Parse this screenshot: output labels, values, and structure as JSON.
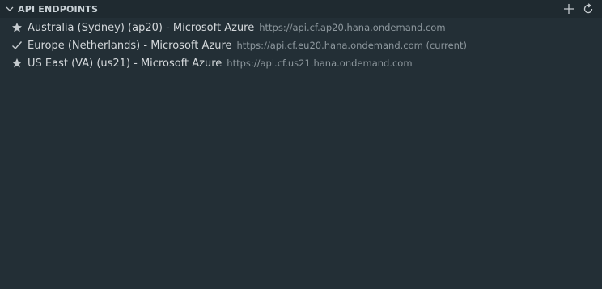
{
  "header": {
    "title": "API ENDPOINTS",
    "chevron_icon": "chevron-down-icon",
    "actions": [
      {
        "name": "add-button",
        "icon": "plus-icon"
      },
      {
        "name": "refresh-button",
        "icon": "refresh-icon"
      }
    ]
  },
  "endpoints": [
    {
      "icon": "star-icon",
      "label": "Australia (Sydney) (ap20) - Microsoft Azure",
      "description": "https://api.cf.ap20.hana.ondemand.com"
    },
    {
      "icon": "check-icon",
      "label": "Europe (Netherlands) - Microsoft Azure",
      "description": "https://api.cf.eu20.hana.ondemand.com (current)"
    },
    {
      "icon": "star-icon",
      "label": "US East (VA) (us21) - Microsoft Azure",
      "description": "https://api.cf.us21.hana.ondemand.com"
    }
  ],
  "colors": {
    "background": "#232f36",
    "header_background": "#1f2a30",
    "text": "#d4d8db",
    "description": "#8e989e",
    "icon": "#c5cbcf"
  }
}
